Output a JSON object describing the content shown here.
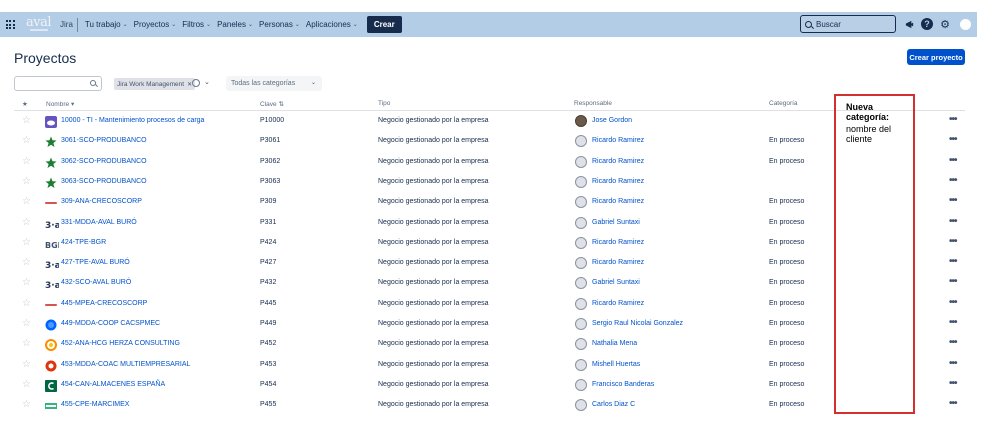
{
  "topnav": {
    "logo": "aval",
    "jira": "Jira",
    "items": [
      "Tu trabajo",
      "Proyectos",
      "Filtros",
      "Paneles",
      "Personas",
      "Aplicaciones"
    ],
    "create_label": "Crear",
    "search_placeholder": "Buscar"
  },
  "page": {
    "title": "Proyectos",
    "create_project_label": "Crear proyecto"
  },
  "filters": {
    "search_value": "",
    "chip_label": "Jira Work Management",
    "category_placeholder": "Todas las categorías"
  },
  "table": {
    "headers": {
      "star": "★",
      "name": "Nombre",
      "key": "Clave",
      "type": "Tipo",
      "lead": "Responsable",
      "category": "Categoría"
    },
    "rows": [
      {
        "name": "10000 - TI - Mantenimiento procesos de carga",
        "key": "P10000",
        "type": "Negocio gestionado por la empresa",
        "lead": "Jose Gordon",
        "category": "",
        "icon": "purple-cloud-icon",
        "color": "#6554c0"
      },
      {
        "name": "3061-SCO-PRODUBANCO",
        "key": "P3061",
        "type": "Negocio gestionado por la empresa",
        "lead": "Ricardo Ramirez",
        "category": "En proceso",
        "icon": "green-star-icon",
        "color": "#1e7d32"
      },
      {
        "name": "3062-SCO-PRODUBANCO",
        "key": "P3062",
        "type": "Negocio gestionado por la empresa",
        "lead": "Ricardo Ramirez",
        "category": "En proceso",
        "icon": "green-star-icon",
        "color": "#1e7d32"
      },
      {
        "name": "3063-SCO-PRODUBANCO",
        "key": "P3063",
        "type": "Negocio gestionado por la empresa",
        "lead": "Ricardo Ramirez",
        "category": "",
        "icon": "green-star-icon",
        "color": "#1e7d32"
      },
      {
        "name": "309-ANA-CRECOSCORP",
        "key": "P309",
        "type": "Negocio gestionado por la empresa",
        "lead": "Ricardo Ramirez",
        "category": "En proceso",
        "icon": "crecos-logo-icon",
        "color": "#d9534f"
      },
      {
        "name": "331-MDDA-AVAL BURÓ",
        "key": "P331",
        "type": "Negocio gestionado por la empresa",
        "lead": "Gabriel Suntaxi",
        "category": "En proceso",
        "icon": "aval-buro-icon",
        "color": "#253858"
      },
      {
        "name": "424-TPE-BGR",
        "key": "P424",
        "type": "Negocio gestionado por la empresa",
        "lead": "Ricardo Ramirez",
        "category": "En proceso",
        "icon": "bgr-logo-icon",
        "color": "#42526e"
      },
      {
        "name": "427-TPE-AVAL BURÓ",
        "key": "P427",
        "type": "Negocio gestionado por la empresa",
        "lead": "Ricardo Ramirez",
        "category": "En proceso",
        "icon": "aval-buro-icon",
        "color": "#253858"
      },
      {
        "name": "432-SCO-AVAL BURÓ",
        "key": "P432",
        "type": "Negocio gestionado por la empresa",
        "lead": "Gabriel Suntaxi",
        "category": "En proceso",
        "icon": "aval-buro-icon",
        "color": "#253858"
      },
      {
        "name": "445-MPEA-CRECOSCORP",
        "key": "P445",
        "type": "Negocio gestionado por la empresa",
        "lead": "Ricardo Ramirez",
        "category": "En proceso",
        "icon": "crecos-logo-icon",
        "color": "#d9534f"
      },
      {
        "name": "449-MDDA-COOP CACSPMEC",
        "key": "P449",
        "type": "Negocio gestionado por la empresa",
        "lead": "Sergio Raul Nicolai Gonzalez",
        "category": "En proceso",
        "icon": "coop-globe-icon",
        "color": "#0065ff"
      },
      {
        "name": "452-ANA-HCG HERZA CONSULTING",
        "key": "P452",
        "type": "Negocio gestionado por la empresa",
        "lead": "Nathalia Mena",
        "category": "En proceso",
        "icon": "herza-logo-icon",
        "color": "#ff8b00"
      },
      {
        "name": "453-MDDA-COAC MULTIEMPRESARIAL",
        "key": "P453",
        "type": "Negocio gestionado por la empresa",
        "lead": "Mishell Huertas",
        "category": "En proceso",
        "icon": "coac-logo-icon",
        "color": "#de350b"
      },
      {
        "name": "454-CAN-ALMACENES ESPAÑA",
        "key": "P454",
        "type": "Negocio gestionado por la empresa",
        "lead": "Francisco Banderas",
        "category": "En proceso",
        "icon": "almacenes-logo-icon",
        "color": "#006644"
      },
      {
        "name": "455-CPE-MARCIMEX",
        "key": "P455",
        "type": "Negocio gestionado por la empresa",
        "lead": "Carlos Diaz C",
        "category": "En proceso",
        "icon": "marcimex-logo-icon",
        "color": "#36b37e"
      }
    ]
  },
  "annotation": {
    "title": "Nueva categoría:",
    "body": "nombre del cliente"
  },
  "colors": {
    "nav_bg": "#b3cde6",
    "primary": "#0052cc",
    "link": "#0052cc",
    "annotation_border": "#d32f2f"
  }
}
